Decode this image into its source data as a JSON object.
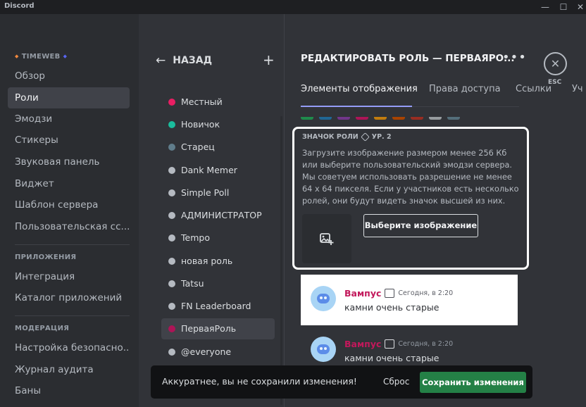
{
  "window": {
    "title": "Discord",
    "controls": {
      "minimize": "—",
      "maximize": "☐",
      "close": "✕"
    }
  },
  "sidebar": {
    "server_name": "TIMEWEB",
    "items": [
      {
        "label": "Обзор",
        "active": false
      },
      {
        "label": "Роли",
        "active": true
      },
      {
        "label": "Эмодзи",
        "active": false
      },
      {
        "label": "Стикеры",
        "active": false
      },
      {
        "label": "Звуковая панель",
        "active": false
      },
      {
        "label": "Виджет",
        "active": false
      },
      {
        "label": "Шаблон сервера",
        "active": false
      },
      {
        "label": "Пользовательская сс...",
        "active": false
      }
    ],
    "apps_heading": "ПРИЛОЖЕНИЯ",
    "apps_items": [
      {
        "label": "Интеграция"
      },
      {
        "label": "Каталог приложений"
      }
    ],
    "moderation_heading": "МОДЕРАЦИЯ",
    "moderation_items": [
      {
        "label": "Настройка безопасно..."
      },
      {
        "label": "Журнал аудита"
      },
      {
        "label": "Баны"
      }
    ]
  },
  "roles_panel": {
    "back_label": "НАЗАД",
    "back_icon": "arrow-left-icon",
    "add_icon": "plus-icon",
    "roles": [
      {
        "name": "Местный",
        "color": "#e91e63"
      },
      {
        "name": "Новичок",
        "color": "#1abc9c"
      },
      {
        "name": "Старец",
        "color": "#607d8b"
      },
      {
        "name": "Dank Memer",
        "color": "#b5bac1"
      },
      {
        "name": "Simple Poll",
        "color": "#b5bac1"
      },
      {
        "name": "АДМИНИСТРАТОР",
        "color": "#b5bac1"
      },
      {
        "name": "Tempo",
        "color": "#b5bac1"
      },
      {
        "name": "новая роль",
        "color": "#b5bac1"
      },
      {
        "name": "Tatsu",
        "color": "#b5bac1"
      },
      {
        "name": "FN Leaderboard",
        "color": "#b5bac1"
      },
      {
        "name": "ПерваяРоль",
        "color": "#ad1457",
        "active": true
      },
      {
        "name": "@everyone",
        "color": "#b5bac1"
      }
    ]
  },
  "main": {
    "title": "РЕДАКТИРОВАТЬ РОЛЬ — ПЕРВАЯРО...",
    "more_icon": "more-icon",
    "close_icon": "close-icon",
    "esc_label": "ESC",
    "tabs": [
      {
        "label": "Элементы отображения",
        "active": true
      },
      {
        "label": "Права доступа",
        "active": false
      },
      {
        "label": "Ссылки",
        "active": false
      },
      {
        "label": "Уч",
        "active": false
      }
    ],
    "swatches": [
      "#1f8b4c",
      "#206694",
      "#71368a",
      "#ad1457",
      "#c27c0e",
      "#a84300",
      "#992d22",
      "#979c9f",
      "#546e7a"
    ],
    "role_icon_card": {
      "heading": "ЗНАЧОК РОЛИ",
      "level_label": "УР. 2",
      "description": "Загрузите изображение размером менее 256 Кб или выберите пользовательский эмодзи сервера. Мы советуем использовать разрешение не менее 64 x 64 пикселя. Если у участников есть несколько ролей, они будут видеть значок высшей из них.",
      "upload_icon": "image-add-icon",
      "choose_label": "Выберите изображение"
    },
    "preview_messages": [
      {
        "author": "Вампус",
        "time": "Сегодня, в 2:20",
        "text": "камни очень старые",
        "theme": "light"
      },
      {
        "author": "Вампус",
        "time": "Сегодня, в 2:20",
        "text": "камни очень старые",
        "theme": "dark"
      }
    ],
    "author_color": "#c2185b"
  },
  "unsaved_bar": {
    "message": "Аккуратнее, вы не сохранили изменения!",
    "reset_label": "Сброс",
    "save_label": "Сохранить изменения"
  }
}
